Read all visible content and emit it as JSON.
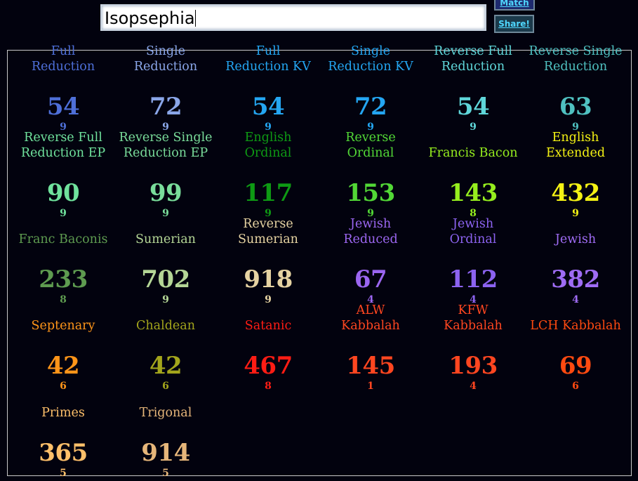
{
  "search": {
    "value": "Isopsephia"
  },
  "buttons": {
    "match": "Match",
    "share": "Share!"
  },
  "ciphers": [
    {
      "l1": "Full",
      "l2": "Reduction",
      "value": "54",
      "reduced": "9",
      "color": "#4e6fd8"
    },
    {
      "l1": "Single",
      "l2": "Reduction",
      "value": "72",
      "reduced": "9",
      "color": "#8aa6e8"
    },
    {
      "l1": "Full",
      "l2": "Reduction KV",
      "value": "54",
      "reduced": "9",
      "color": "#24a6f2"
    },
    {
      "l1": "Single",
      "l2": "Reduction KV",
      "value": "72",
      "reduced": "9",
      "color": "#24a6f2"
    },
    {
      "l1": "Reverse Full",
      "l2": "Reduction",
      "value": "54",
      "reduced": "9",
      "color": "#5fd6d9"
    },
    {
      "l1": "Reverse Single",
      "l2": "Reduction",
      "value": "63",
      "reduced": "9",
      "color": "#4fc0c0"
    },
    {
      "l1": "Reverse Full",
      "l2": "Reduction EP",
      "value": "90",
      "reduced": "9",
      "color": "#6fe29c"
    },
    {
      "l1": "Reverse Single",
      "l2": "Reduction EP",
      "value": "99",
      "reduced": "9",
      "color": "#79dc9a"
    },
    {
      "l1": "English",
      "l2": "Ordinal",
      "value": "117",
      "reduced": "9",
      "color": "#0e9a14"
    },
    {
      "l1": "Reverse",
      "l2": "Ordinal",
      "value": "153",
      "reduced": "9",
      "color": "#52d836"
    },
    {
      "l1": "",
      "l2": "Francis Bacon",
      "value": "143",
      "reduced": "8",
      "color": "#96ee1e"
    },
    {
      "l1": "English",
      "l2": "Extended",
      "value": "432",
      "reduced": "9",
      "color": "#f4f214"
    },
    {
      "l1": "",
      "l2": "Franc Baconis",
      "value": "233",
      "reduced": "8",
      "color": "#5e9b50"
    },
    {
      "l1": "",
      "l2": "Sumerian",
      "value": "702",
      "reduced": "9",
      "color": "#b4d696"
    },
    {
      "l1": "Reverse",
      "l2": "Sumerian",
      "value": "918",
      "reduced": "9",
      "color": "#e6d3a2"
    },
    {
      "l1": "Jewish",
      "l2": "Reduced",
      "value": "67",
      "reduced": "4",
      "color": "#9b66f0"
    },
    {
      "l1": "Jewish",
      "l2": "Ordinal",
      "value": "112",
      "reduced": "4",
      "color": "#8c63f0"
    },
    {
      "l1": "",
      "l2": "Jewish",
      "value": "382",
      "reduced": "4",
      "color": "#9f6cf4"
    },
    {
      "l1": "",
      "l2": "Septenary",
      "value": "42",
      "reduced": "6",
      "color": "#ff9519"
    },
    {
      "l1": "",
      "l2": "Chaldean",
      "value": "42",
      "reduced": "6",
      "color": "#a3a51c"
    },
    {
      "l1": "",
      "l2": "Satanic",
      "value": "467",
      "reduced": "8",
      "color": "#ff1c14"
    },
    {
      "l1": "ALW",
      "l2": "Kabbalah",
      "value": "145",
      "reduced": "1",
      "color": "#ff4620"
    },
    {
      "l1": "KFW",
      "l2": "Kabbalah",
      "value": "193",
      "reduced": "4",
      "color": "#ff4620"
    },
    {
      "l1": "",
      "l2": "LCH Kabbalah",
      "value": "69",
      "reduced": "6",
      "color": "#ff4a10"
    },
    {
      "l1": "",
      "l2": "Primes",
      "value": "365",
      "reduced": "5",
      "color": "#ffc06a"
    },
    {
      "l1": "",
      "l2": "Trigonal",
      "value": "914",
      "reduced": "5",
      "color": "#e6b67a"
    }
  ]
}
